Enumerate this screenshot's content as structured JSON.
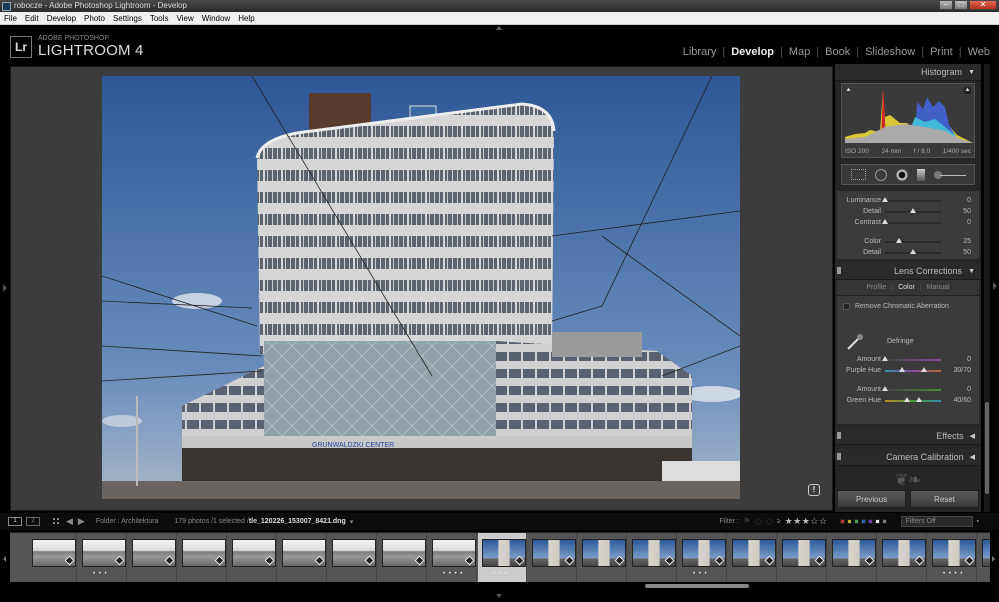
{
  "window": {
    "title": "robocze - Adobe Photoshop Lightroom - Develop",
    "controls": [
      "minimize",
      "maximize",
      "close"
    ]
  },
  "menu": [
    "File",
    "Edit",
    "Develop",
    "Photo",
    "Settings",
    "Tools",
    "View",
    "Window",
    "Help"
  ],
  "identity": {
    "logo": "Lr",
    "line1": "ADOBE PHOTOSHOP",
    "line2": "LIGHTROOM 4"
  },
  "modules": [
    {
      "label": "Library",
      "active": false
    },
    {
      "label": "Develop",
      "active": true
    },
    {
      "label": "Map",
      "active": false
    },
    {
      "label": "Book",
      "active": false
    },
    {
      "label": "Slideshow",
      "active": false
    },
    {
      "label": "Print",
      "active": false
    },
    {
      "label": "Web",
      "active": false
    }
  ],
  "histogram": {
    "title": "Histogram",
    "exif": {
      "iso": "ISO 200",
      "focal": "24 mm",
      "aperture": "f / 8,0",
      "shutter": "1/400 sec"
    }
  },
  "tools": [
    "crop-overlay",
    "spot-removal",
    "red-eye-correction",
    "graduated-filter",
    "adjustment-brush"
  ],
  "detail": {
    "sliders": [
      {
        "label": "Luminance",
        "value": "0",
        "fraction": 0.0
      },
      {
        "label": "Detail",
        "value": "50",
        "fraction": 0.5
      },
      {
        "label": "Contrast",
        "value": "0",
        "fraction": 0.0
      },
      {
        "label": "Color",
        "value": "25",
        "fraction": 0.25
      },
      {
        "label": "Detail",
        "value": "50",
        "fraction": 0.5
      }
    ]
  },
  "lens_corrections": {
    "title": "Lens Corrections",
    "tabs": [
      {
        "label": "Profile",
        "active": false
      },
      {
        "label": "Color",
        "active": true
      },
      {
        "label": "Manual",
        "active": false
      }
    ],
    "remove_ca_label": "Remove Chromatic Aberration",
    "remove_ca_checked": false,
    "defringe_label": "Defringe",
    "purple_amount": {
      "label": "Amount",
      "value": "0",
      "fraction": 0.0
    },
    "purple_hue": {
      "label": "Purple Hue",
      "value": "30/70",
      "low": 0.3,
      "high": 0.7
    },
    "green_amount": {
      "label": "Amount",
      "value": "0",
      "fraction": 0.0
    },
    "green_hue": {
      "label": "Green Hue",
      "value": "40/60",
      "low": 0.4,
      "high": 0.6
    }
  },
  "collapsed_panels": [
    "Effects",
    "Camera Calibration"
  ],
  "buttons": {
    "previous": "Previous",
    "reset": "Reset"
  },
  "filmstrip_bar": {
    "view1": "1",
    "view2": "2",
    "folder": "Folder : Architektura",
    "count": "179 photos /1 selected /",
    "filename": "tle_120226_153007_8421.dng",
    "filter_label": "Filter :",
    "rating_op": "≥",
    "stars_filled": 3,
    "stars_total": 5,
    "label_colors": [
      "#c03030",
      "#c0b030",
      "#40a040",
      "#3060c0",
      "#7040b0",
      "#eeeeee",
      "#777777"
    ],
    "filters_value": "Filters Off"
  },
  "filmstrip": {
    "thumbs": [
      {
        "tone": "gray",
        "dots": ""
      },
      {
        "tone": "gray",
        "dots": "• • •"
      },
      {
        "tone": "gray",
        "dots": ""
      },
      {
        "tone": "gray",
        "dots": ""
      },
      {
        "tone": "gray",
        "dots": ""
      },
      {
        "tone": "gray",
        "dots": ""
      },
      {
        "tone": "gray",
        "dots": ""
      },
      {
        "tone": "gray",
        "dots": ""
      },
      {
        "tone": "gray",
        "dots": "• • • •"
      },
      {
        "tone": "blue",
        "dots": "• • •",
        "selected": true
      },
      {
        "tone": "blue",
        "dots": ""
      },
      {
        "tone": "blue",
        "dots": ""
      },
      {
        "tone": "blue",
        "dots": ""
      },
      {
        "tone": "blue",
        "dots": "• • •"
      },
      {
        "tone": "blue",
        "dots": ""
      },
      {
        "tone": "blue",
        "dots": ""
      },
      {
        "tone": "blue",
        "dots": ""
      },
      {
        "tone": "blue",
        "dots": ""
      },
      {
        "tone": "blue",
        "dots": "• • • •"
      },
      {
        "tone": "blue",
        "dots": ""
      }
    ]
  },
  "photo": {
    "sign_text": "GRUNWALDZKI CENTER"
  }
}
